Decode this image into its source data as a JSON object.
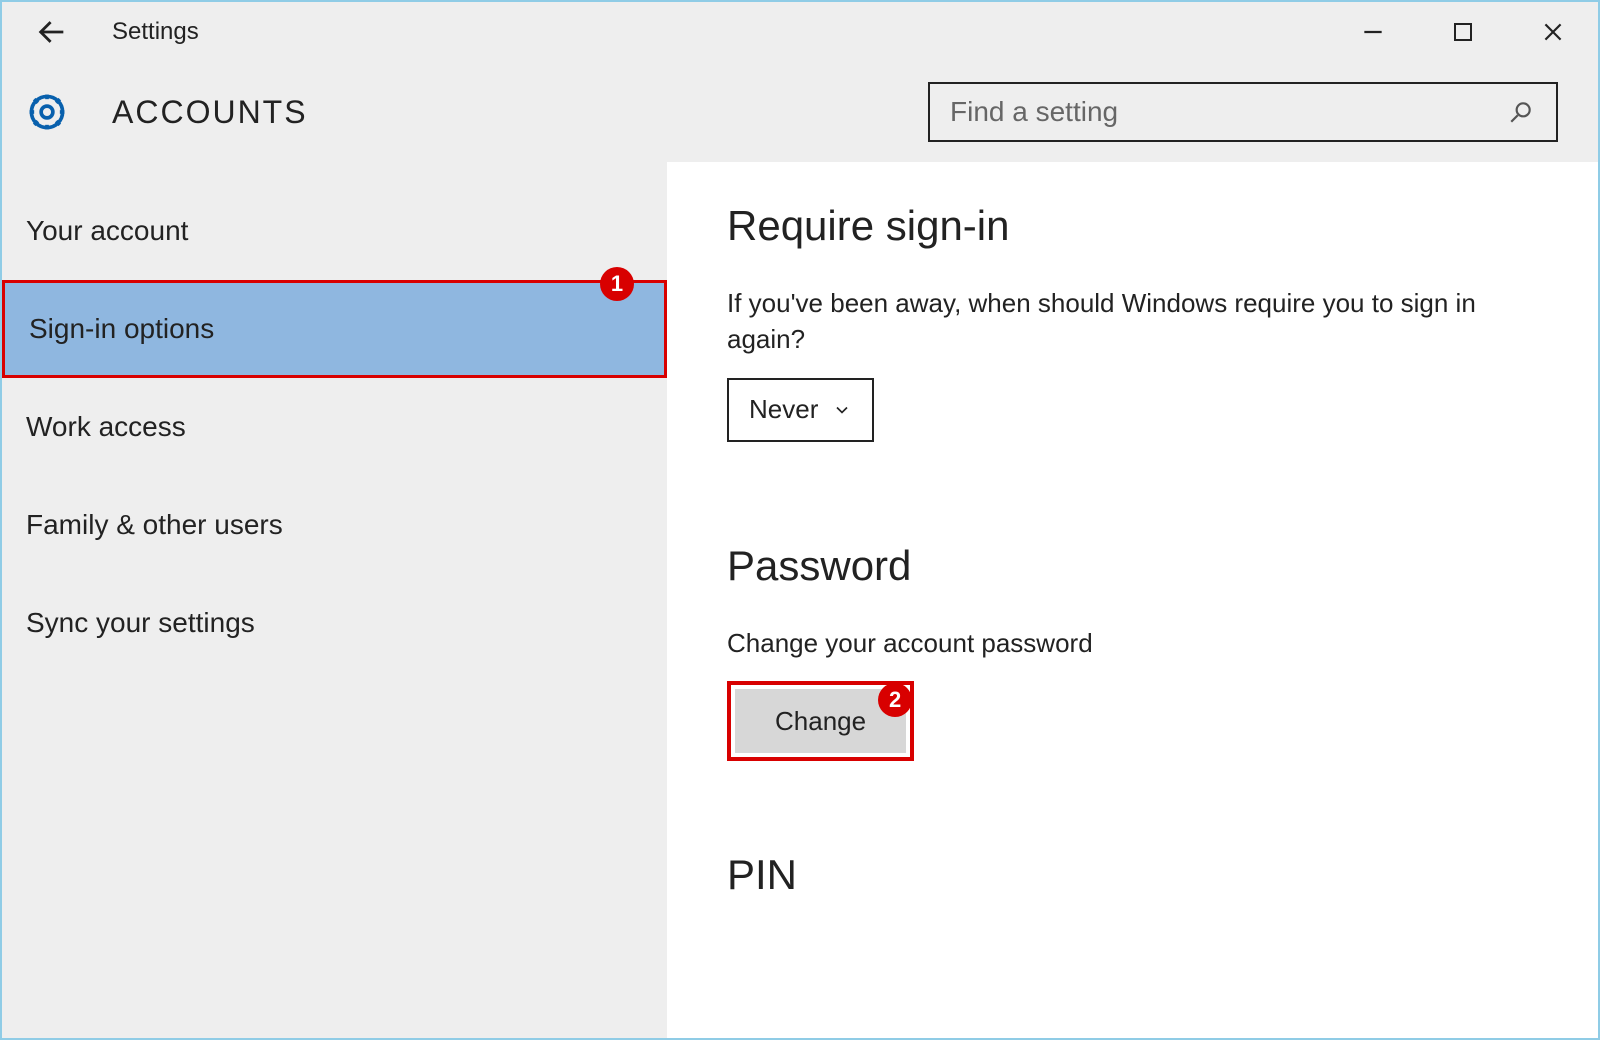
{
  "titlebar": {
    "title": "Settings"
  },
  "header": {
    "section_title": "ACCOUNTS",
    "search_placeholder": "Find a setting"
  },
  "sidebar": {
    "items": [
      {
        "label": "Your account",
        "selected": false
      },
      {
        "label": "Sign-in options",
        "selected": true,
        "annotation": "1"
      },
      {
        "label": "Work access",
        "selected": false
      },
      {
        "label": "Family & other users",
        "selected": false
      },
      {
        "label": "Sync your settings",
        "selected": false
      }
    ]
  },
  "main": {
    "require_signin": {
      "heading": "Require sign-in",
      "description": "If you've been away, when should Windows require you to sign in again?",
      "dropdown_value": "Never"
    },
    "password": {
      "heading": "Password",
      "description": "Change your account password",
      "button_label": "Change",
      "annotation": "2"
    },
    "pin": {
      "heading": "PIN"
    }
  },
  "colors": {
    "accent_blue": "#0860ad",
    "highlight_red": "#d80000",
    "sidebar_bg": "#eeeeee",
    "selected_bg": "#8fb7e0"
  }
}
